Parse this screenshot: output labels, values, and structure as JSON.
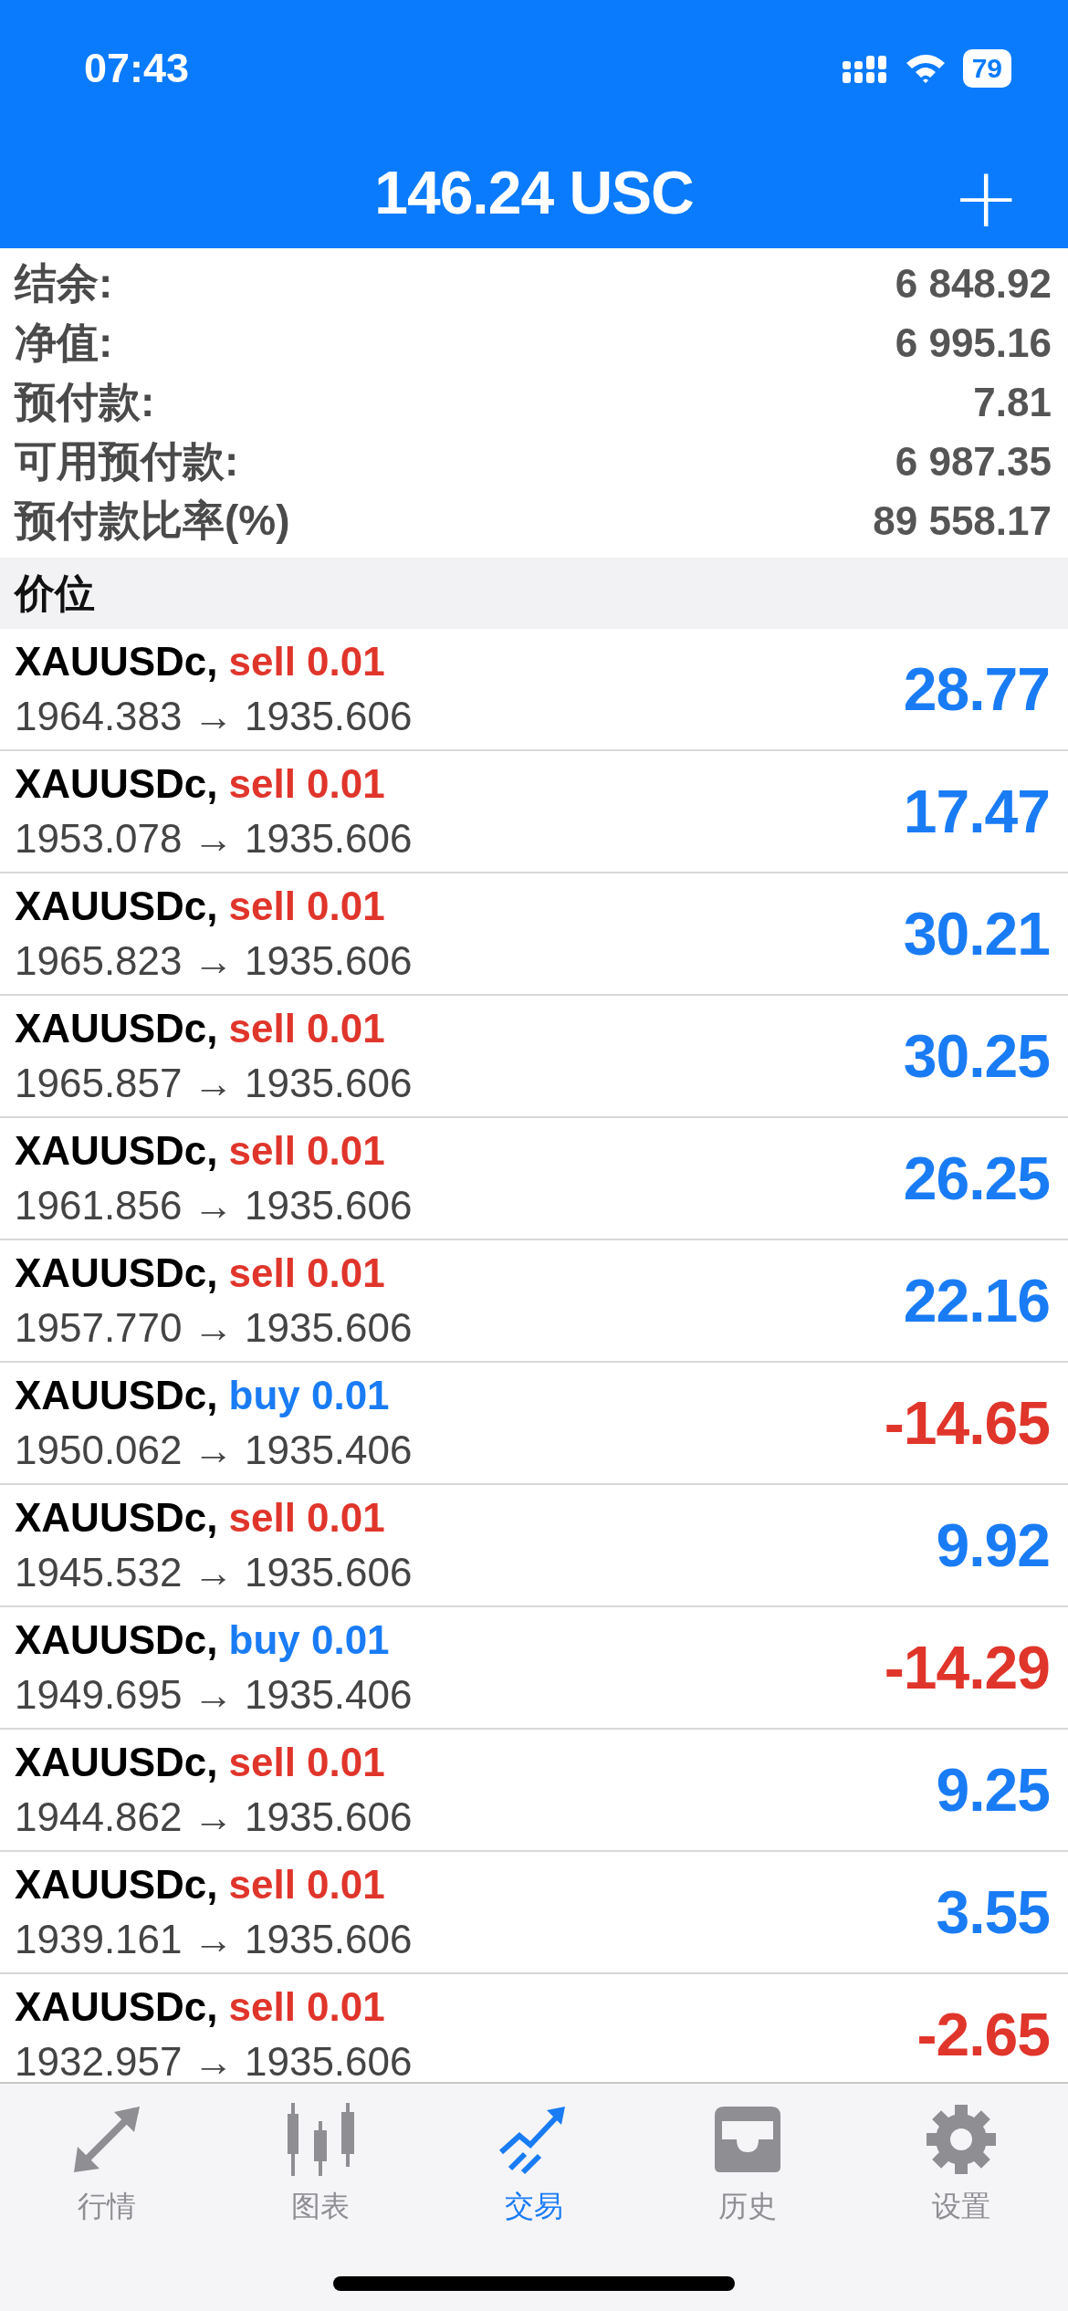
{
  "status_bar": {
    "time": "07:43",
    "battery": "79"
  },
  "header": {
    "title": "146.24 USC",
    "add": "+"
  },
  "summary": [
    {
      "label": "结余:",
      "value": "6 848.92"
    },
    {
      "label": "净值:",
      "value": "6 995.16"
    },
    {
      "label": "预付款:",
      "value": "7.81"
    },
    {
      "label": "可用预付款:",
      "value": "6 987.35"
    },
    {
      "label": "预付款比率(%)",
      "value": "89 558.17"
    }
  ],
  "section_title": "价位",
  "positions": [
    {
      "symbol": "XAUUSDc,",
      "kind": "sell",
      "trade": "sell 0.01",
      "prices": "1964.383 → 1935.606",
      "profit": "28.77",
      "loss": false
    },
    {
      "symbol": "XAUUSDc,",
      "kind": "sell",
      "trade": "sell 0.01",
      "prices": "1953.078 → 1935.606",
      "profit": "17.47",
      "loss": false
    },
    {
      "symbol": "XAUUSDc,",
      "kind": "sell",
      "trade": "sell 0.01",
      "prices": "1965.823 → 1935.606",
      "profit": "30.21",
      "loss": false
    },
    {
      "symbol": "XAUUSDc,",
      "kind": "sell",
      "trade": "sell 0.01",
      "prices": "1965.857 → 1935.606",
      "profit": "30.25",
      "loss": false
    },
    {
      "symbol": "XAUUSDc,",
      "kind": "sell",
      "trade": "sell 0.01",
      "prices": "1961.856 → 1935.606",
      "profit": "26.25",
      "loss": false
    },
    {
      "symbol": "XAUUSDc,",
      "kind": "sell",
      "trade": "sell 0.01",
      "prices": "1957.770 → 1935.606",
      "profit": "22.16",
      "loss": false
    },
    {
      "symbol": "XAUUSDc,",
      "kind": "buy",
      "trade": "buy 0.01",
      "prices": "1950.062 → 1935.406",
      "profit": "-14.65",
      "loss": true
    },
    {
      "symbol": "XAUUSDc,",
      "kind": "sell",
      "trade": "sell 0.01",
      "prices": "1945.532 → 1935.606",
      "profit": "9.92",
      "loss": false
    },
    {
      "symbol": "XAUUSDc,",
      "kind": "buy",
      "trade": "buy 0.01",
      "prices": "1949.695 → 1935.406",
      "profit": "-14.29",
      "loss": true
    },
    {
      "symbol": "XAUUSDc,",
      "kind": "sell",
      "trade": "sell 0.01",
      "prices": "1944.862 → 1935.606",
      "profit": "9.25",
      "loss": false
    },
    {
      "symbol": "XAUUSDc,",
      "kind": "sell",
      "trade": "sell 0.01",
      "prices": "1939.161 → 1935.606",
      "profit": "3.55",
      "loss": false
    },
    {
      "symbol": "XAUUSDc,",
      "kind": "sell",
      "trade": "sell 0.01",
      "prices": "1932.957 → 1935.606",
      "profit": "-2.65",
      "loss": true
    }
  ],
  "tabs": [
    {
      "label": "行情",
      "kind": "quotes",
      "selected": false
    },
    {
      "label": "图表",
      "kind": "chart",
      "selected": false
    },
    {
      "label": "交易",
      "kind": "trade",
      "selected": true
    },
    {
      "label": "历史",
      "kind": "history",
      "selected": false
    },
    {
      "label": "设置",
      "kind": "settings",
      "selected": false
    }
  ]
}
